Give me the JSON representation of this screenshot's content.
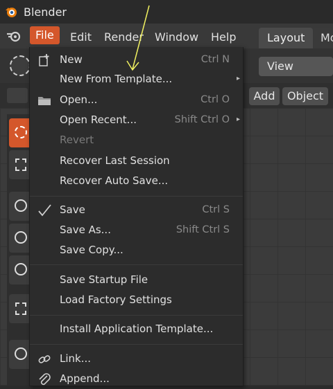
{
  "app": {
    "title": "Blender"
  },
  "menubar": {
    "items": [
      {
        "label": "File"
      },
      {
        "label": "Edit"
      },
      {
        "label": "Render"
      },
      {
        "label": "Window"
      },
      {
        "label": "Help"
      }
    ]
  },
  "workspace_tabs": [
    {
      "label": "Layout"
    },
    {
      "label": "Mo"
    }
  ],
  "header": {
    "view_label": "View",
    "add_label": "Add",
    "object_label": "Object"
  },
  "file_menu": {
    "items": [
      {
        "label": "New",
        "shortcut": "Ctrl N",
        "icon": "new-file-icon",
        "submenu": false
      },
      {
        "label": "New From Template...",
        "shortcut": "",
        "submenu": true
      },
      {
        "label": "Open...",
        "shortcut": "Ctrl O",
        "icon": "folder-icon",
        "submenu": false
      },
      {
        "label": "Open Recent...",
        "shortcut": "Shift Ctrl O",
        "submenu": true
      },
      {
        "label": "Revert",
        "shortcut": "",
        "disabled": true
      },
      {
        "label": "Recover Last Session",
        "shortcut": ""
      },
      {
        "label": "Recover Auto Save...",
        "shortcut": ""
      },
      {
        "label": "Save",
        "shortcut": "Ctrl S",
        "icon": "checkmark-icon"
      },
      {
        "label": "Save As...",
        "shortcut": "Shift Ctrl S"
      },
      {
        "label": "Save Copy...",
        "shortcut": ""
      },
      {
        "label": "Save Startup File",
        "shortcut": ""
      },
      {
        "label": "Load Factory Settings",
        "shortcut": ""
      },
      {
        "label": "Install Application Template...",
        "shortcut": ""
      },
      {
        "label": "Link...",
        "shortcut": "",
        "icon": "link-icon"
      },
      {
        "label": "Append...",
        "shortcut": "",
        "icon": "paperclip-icon"
      }
    ]
  },
  "colors": {
    "accent": "#d4572b",
    "menu_bg": "#2c2c2c",
    "annotation": "#f0f060"
  }
}
